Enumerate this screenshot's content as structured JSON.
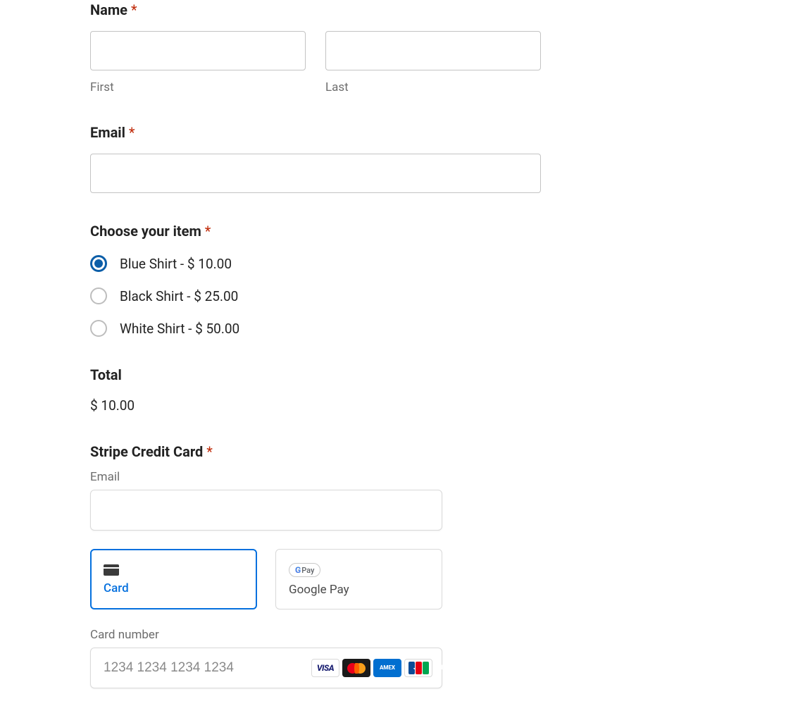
{
  "name": {
    "label": "Name",
    "first_sublabel": "First",
    "last_sublabel": "Last",
    "first_value": "",
    "last_value": ""
  },
  "email": {
    "label": "Email",
    "value": ""
  },
  "item_choice": {
    "label": "Choose your item",
    "options": [
      {
        "label": "Blue Shirt - $ 10.00",
        "selected": true
      },
      {
        "label": "Black Shirt - $ 25.00",
        "selected": false
      },
      {
        "label": "White Shirt - $ 50.00",
        "selected": false
      }
    ]
  },
  "total": {
    "label": "Total",
    "value": "$ 10.00"
  },
  "stripe": {
    "label": "Stripe Credit Card",
    "email_label": "Email",
    "email_value": "",
    "payment_methods": {
      "card_label": "Card",
      "gpay_label": "Google Pay",
      "gpay_badge_g": "G",
      "gpay_badge_pay": "Pay"
    },
    "card_number": {
      "label": "Card number",
      "placeholder": "1234 1234 1234 1234",
      "value": ""
    },
    "brands": {
      "visa": "VISA",
      "amex_line1": "AM",
      "amex_line2": "EX",
      "jcb_j": "J",
      "jcb_c": "C",
      "jcb_b": "B"
    }
  },
  "required_marker": "*"
}
